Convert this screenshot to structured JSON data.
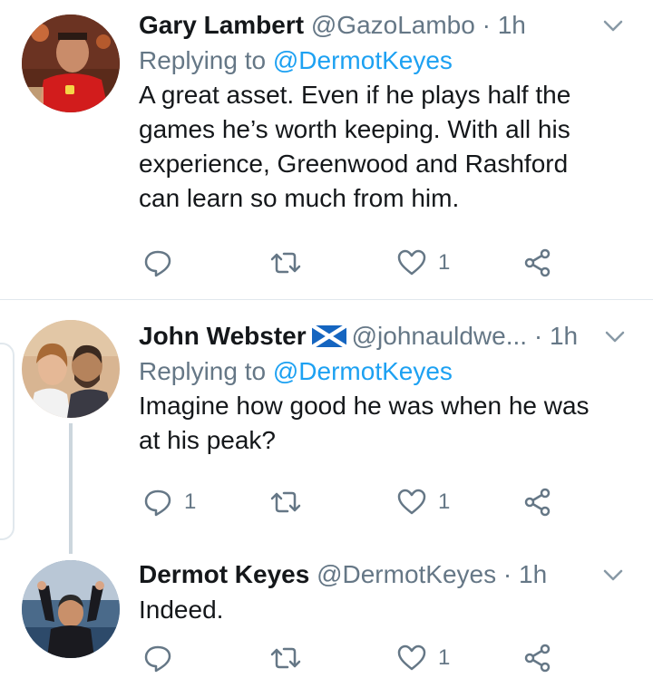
{
  "tweets": [
    {
      "name": "Gary Lambert",
      "handle": "@GazoLambo",
      "dot": "·",
      "time": "1h",
      "replying_prefix": "Replying to",
      "replying_to": "@DermotKeyes",
      "text_lines": [
        "A great asset. Even if he plays half the",
        "games he’s worth keeping. With all his",
        "experience, Greenwood and Rashford",
        "can learn so much from him."
      ],
      "reply_count": "",
      "retweet_count": "",
      "like_count": "1"
    },
    {
      "name": "John Webster",
      "flag_icon": "scotland-flag-icon",
      "handle": "@johnauldwe...",
      "dot": "·",
      "time": "1h",
      "replying_prefix": "Replying to",
      "replying_to": "@DermotKeyes",
      "text_lines": [
        "Imagine how good he was when he was",
        "at his peak?"
      ],
      "reply_count": "1",
      "retweet_count": "",
      "like_count": "1"
    },
    {
      "name": "Dermot Keyes",
      "handle": "@DermotKeyes",
      "dot": "·",
      "time": "1h",
      "text_lines": [
        "Indeed."
      ],
      "reply_count": "",
      "retweet_count": "",
      "like_count": "1"
    }
  ],
  "colors": {
    "text": "#14171a",
    "secondary": "#657786",
    "link": "#1da1f2",
    "divider": "#e1e8ed",
    "thread_line": "#ccd6dd"
  },
  "icons": [
    "reply-icon",
    "retweet-icon",
    "like-icon",
    "share-icon",
    "chevron-down-icon"
  ]
}
